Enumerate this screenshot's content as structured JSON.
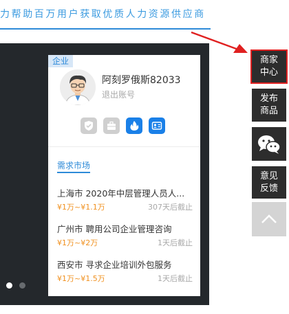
{
  "banner": {
    "slogan": "力帮助百万用户获取优质人力资源供应商"
  },
  "hero": {
    "slides": 2,
    "active_slide": 1
  },
  "user_card": {
    "type_tag": "企业",
    "user_name": "阿刻罗俄斯82033",
    "logout_label": "退出账号",
    "badges": [
      {
        "icon": "verified-shield-icon",
        "active": false
      },
      {
        "icon": "briefcase-icon",
        "active": false
      },
      {
        "icon": "flame-icon",
        "active": true
      },
      {
        "icon": "id-card-icon",
        "active": true
      }
    ],
    "section_title": "需求市场",
    "demands": [
      {
        "title": "上海市 2020年中层管理人员人...",
        "price": "¥1万~¥1.1万",
        "deadline": "307天后截止"
      },
      {
        "title": "广州市 聘用公司企业管理咨询",
        "price": "¥1万~¥2万",
        "deadline": "1天后截止"
      },
      {
        "title": "西安市 寻求企业培训外包服务",
        "price": "¥1万~¥1.5万",
        "deadline": "1天后截止"
      }
    ]
  },
  "sidebar": {
    "merchant_center": [
      "商家",
      "中心"
    ],
    "publish_goods": [
      "发布",
      "商品"
    ],
    "wechat_icon": "wechat-icon",
    "feedback": [
      "意见",
      "反馈"
    ],
    "back_to_top_icon": "chevron-up-icon"
  },
  "colors": {
    "accent": "#2d8ad8",
    "price": "#f0901e",
    "highlight": "#e02020",
    "sidebar_bg": "#2d2d2d"
  }
}
